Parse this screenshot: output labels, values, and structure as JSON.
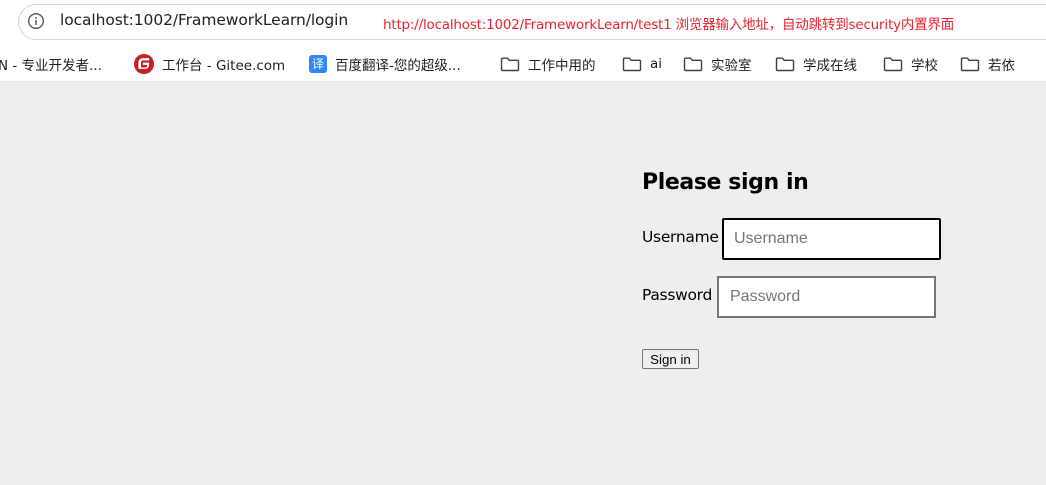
{
  "address_bar": {
    "url": "localhost:1002/FrameworkLearn/login",
    "info_icon": "info-icon",
    "annotation": "http://localhost:1002/FrameworkLearn/test1   浏览器输入地址，自动跳转到security内置界面",
    "annotation_color": "#e8232f"
  },
  "bookmarks": [
    {
      "label": "N - 专业开发者...",
      "icon": "none"
    },
    {
      "label": "工作台 - Gitee.com",
      "icon": "gitee-icon"
    },
    {
      "label": "百度翻译-您的超级...",
      "icon": "fanyi-icon",
      "icon_glyph": "译"
    },
    {
      "label": "工作中用的",
      "icon": "folder-icon"
    },
    {
      "label": "ai",
      "icon": "folder-icon"
    },
    {
      "label": "实验室",
      "icon": "folder-icon"
    },
    {
      "label": "学成在线",
      "icon": "folder-icon"
    },
    {
      "label": "学校",
      "icon": "folder-icon"
    },
    {
      "label": "若依",
      "icon": "folder-icon"
    }
  ],
  "login": {
    "title": "Please sign in",
    "username_label": "Username",
    "username_placeholder": "Username",
    "password_label": "Password",
    "password_placeholder": "Password",
    "signin_label": "Sign in"
  },
  "colors": {
    "page_background": "#eeeeee",
    "gitee_red": "#c71d23",
    "fanyi_blue": "#2e88f5"
  }
}
